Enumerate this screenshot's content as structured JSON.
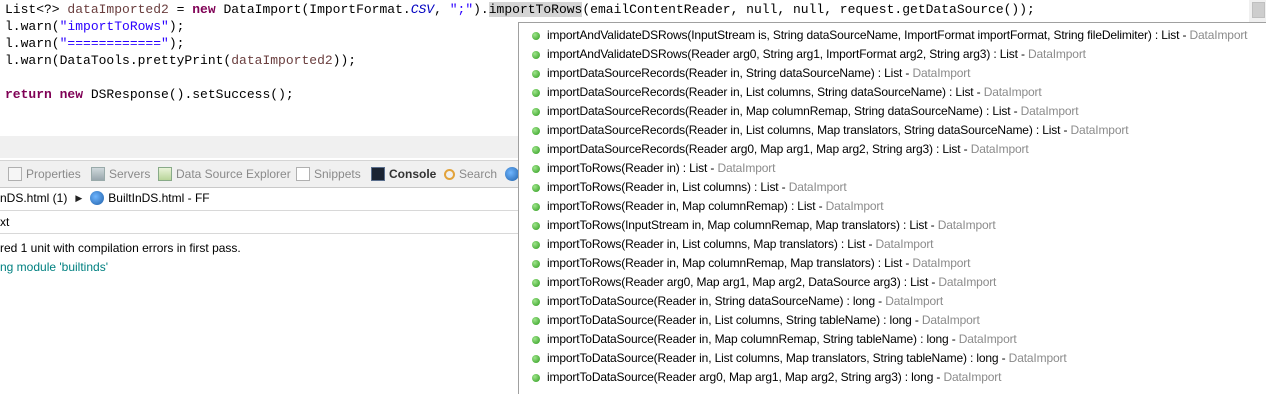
{
  "editor": {
    "line1": {
      "pre": "List<?> ",
      "var": "dataImported2",
      "mid1": " = ",
      "kw_new": "new",
      "mid2": " DataImport(ImportFormat.",
      "field": "CSV",
      "mid3": ", ",
      "str": "\";\"",
      "mid4": ").",
      "method": "importToRows",
      "post": "(emailContentReader, null, null, request.getDataSource());"
    },
    "line2": {
      "pre": "l.warn(",
      "str": "\"importToRows\"",
      "post": ");"
    },
    "line3": {
      "pre": "l.warn(",
      "str": "\"============\"",
      "post": ");"
    },
    "line4": {
      "pre": "l.warn(DataTools.prettyPrint(",
      "var": "dataImported2",
      "post": "));"
    },
    "line5": {
      "kw_return": "return",
      "mid": " ",
      "kw_new": "new",
      "post": " DSResponse().setSuccess();"
    }
  },
  "view_tabs": [
    {
      "label": "Properties",
      "icon": "properties-icon"
    },
    {
      "label": "Servers",
      "icon": "servers-icon"
    },
    {
      "label": "Data Source Explorer",
      "icon": "data-source-explorer-icon"
    },
    {
      "label": "Snippets",
      "icon": "snippets-icon"
    },
    {
      "label": "Console",
      "icon": "console-icon"
    },
    {
      "label": "Search",
      "icon": "search-icon"
    }
  ],
  "console": {
    "breadcrumb_left": "nDS.html (1)",
    "breadcrumb_right": "BuiltInDS.html - FF",
    "filter_text": "xt",
    "lines": [
      "red 1 unit with compilation errors in first pass.",
      "ng module 'builtinds'"
    ]
  },
  "content_assist": {
    "items": [
      {
        "sig": "importAndValidateDSRows(InputStream is, String dataSourceName, ImportFormat importFormat, String fileDelimiter) : List - ",
        "owner": "DataImport"
      },
      {
        "sig": "importAndValidateDSRows(Reader arg0, String arg1, ImportFormat arg2, String arg3) : List - ",
        "owner": "DataImport"
      },
      {
        "sig": "importDataSourceRecords(Reader in, String dataSourceName) : List - ",
        "owner": "DataImport"
      },
      {
        "sig": "importDataSourceRecords(Reader in, List columns, String dataSourceName) : List - ",
        "owner": "DataImport"
      },
      {
        "sig": "importDataSourceRecords(Reader in, Map columnRemap, String dataSourceName) : List - ",
        "owner": "DataImport"
      },
      {
        "sig": "importDataSourceRecords(Reader in, List columns, Map translators, String dataSourceName) : List - ",
        "owner": "DataImport"
      },
      {
        "sig": "importDataSourceRecords(Reader arg0, Map arg1, Map arg2, String arg3) : List - ",
        "owner": "DataImport"
      },
      {
        "sig": "importToRows(Reader in) : List - ",
        "owner": "DataImport"
      },
      {
        "sig": "importToRows(Reader in, List columns) : List - ",
        "owner": "DataImport"
      },
      {
        "sig": "importToRows(Reader in, Map columnRemap) : List - ",
        "owner": "DataImport"
      },
      {
        "sig": "importToRows(InputStream in, Map columnRemap, Map translators) : List - ",
        "owner": "DataImport"
      },
      {
        "sig": "importToRows(Reader in, List columns, Map translators) : List - ",
        "owner": "DataImport"
      },
      {
        "sig": "importToRows(Reader in, Map columnRemap, Map translators) : List - ",
        "owner": "DataImport"
      },
      {
        "sig": "importToRows(Reader arg0, Map arg1, Map arg2, DataSource arg3) : List - ",
        "owner": "DataImport"
      },
      {
        "sig": "importToDataSource(Reader in, String dataSourceName) : long - ",
        "owner": "DataImport"
      },
      {
        "sig": "importToDataSource(Reader in, List columns, String tableName) : long - ",
        "owner": "DataImport"
      },
      {
        "sig": "importToDataSource(Reader in, Map columnRemap, String tableName) : long - ",
        "owner": "DataImport"
      },
      {
        "sig": "importToDataSource(Reader in, List columns, Map translators, String tableName) : long - ",
        "owner": "DataImport"
      },
      {
        "sig": "importToDataSource(Reader arg0, Map arg1, Map arg2, String arg3) : long - ",
        "owner": "DataImport"
      }
    ]
  }
}
